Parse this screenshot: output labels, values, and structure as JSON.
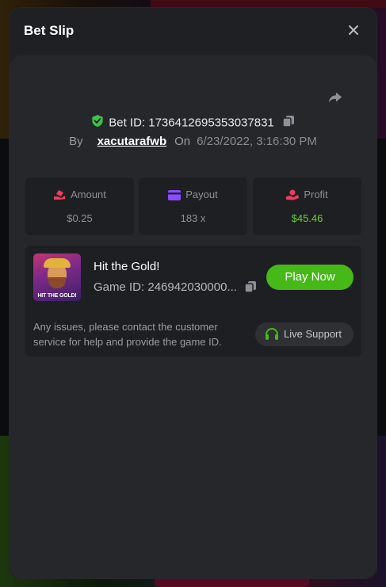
{
  "modal": {
    "title": "Bet Slip",
    "close_icon": "close-icon"
  },
  "bet": {
    "id_text": "Bet ID: 1736412695353037831",
    "by_label": "By",
    "user": "xacutarafwb",
    "on_label": "On",
    "datetime": "6/23/2022, 3:16:30 PM"
  },
  "stats": [
    {
      "label": "Amount",
      "value": "$0.25",
      "icon": "hand-coins-icon",
      "value_color": "#8e9098"
    },
    {
      "label": "Payout",
      "value": "183 x",
      "icon": "card-icon",
      "value_color": "#8e9098"
    },
    {
      "label": "Profit",
      "value": "$45.46",
      "icon": "hand-coin-icon",
      "value_color": "#6ad12d"
    }
  ],
  "game": {
    "name": "Hit the Gold!",
    "id_text": "Game ID: 246942030000...",
    "thumb_caption": "HIT THE GOLD!",
    "play_label": "Play Now",
    "issues_text": "Any issues, please contact the customer service for help and provide the game ID.",
    "support_label": "Live Support"
  },
  "colors": {
    "accent_green": "#46b818",
    "profit_green": "#6ad12d",
    "icon_pink": "#ee3d5a",
    "icon_purple": "#8a4dff"
  }
}
